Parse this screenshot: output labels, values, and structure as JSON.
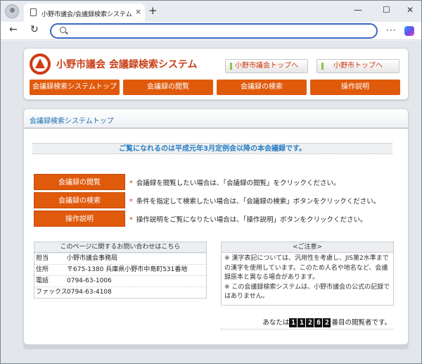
{
  "browser": {
    "tab_title": "小野市議会/会議録検索システム",
    "tab_close": "×",
    "new_tab": "+",
    "address_value": "",
    "win_min": "—",
    "win_max": "☐",
    "win_close": "✕",
    "back": "←",
    "reload": "↻",
    "more": "···"
  },
  "site": {
    "title": "小野市議会 会議録検索システム",
    "top_links": [
      "小野市議会トップへ",
      "小野市トップへ"
    ],
    "nav": [
      "会議録検索システムトップ",
      "会議録の閲覧",
      "会議録の検索",
      "操作説明"
    ],
    "accent_color": "#e05a0c"
  },
  "content": {
    "heading": "会議録検索システムトップ",
    "notice": "ご覧になれるのは平成元年3月定例会以降の本会議録です。",
    "actions": [
      {
        "label": "会議録の閲覧",
        "desc": "会議録を閲覧したい場合は、「会議録の閲覧」をクリックください。"
      },
      {
        "label": "会議録の検索",
        "desc": "条件を指定して検索したい場合は、「会議録の検索」ボタンをクリックください。"
      },
      {
        "label": "操作説明",
        "desc": "操作説明をご覧になりたい場合は、「操作説明」ボタンをクリックください。"
      }
    ],
    "contact": {
      "title": "このページに関するお問い合わせはこちら",
      "rows": [
        {
          "label": "担当",
          "value": "小野市議会事務局"
        },
        {
          "label": "住所",
          "value": "〒675-1380 兵庫県小野市中島町531番地"
        },
        {
          "label": "電話",
          "value": "0794-63-1006"
        },
        {
          "label": "ファックス",
          "value": "0794-63-4108"
        }
      ]
    },
    "caution": {
      "title": "<ご注意>",
      "text1": "※ 漢字表記については、汎用性を考慮し、JIS第2水準までの漢字を使用しています。このため人名や地名など、会議録原本と異なる場合があります。",
      "text2": "※ この会議録検索システムは、小野市議会の公式の記録ではありません。"
    },
    "counter": {
      "prefix": "あなたは",
      "digits": [
        "1",
        "1",
        "2",
        "6",
        "2"
      ],
      "suffix": "番目の閲覧者です。"
    }
  }
}
